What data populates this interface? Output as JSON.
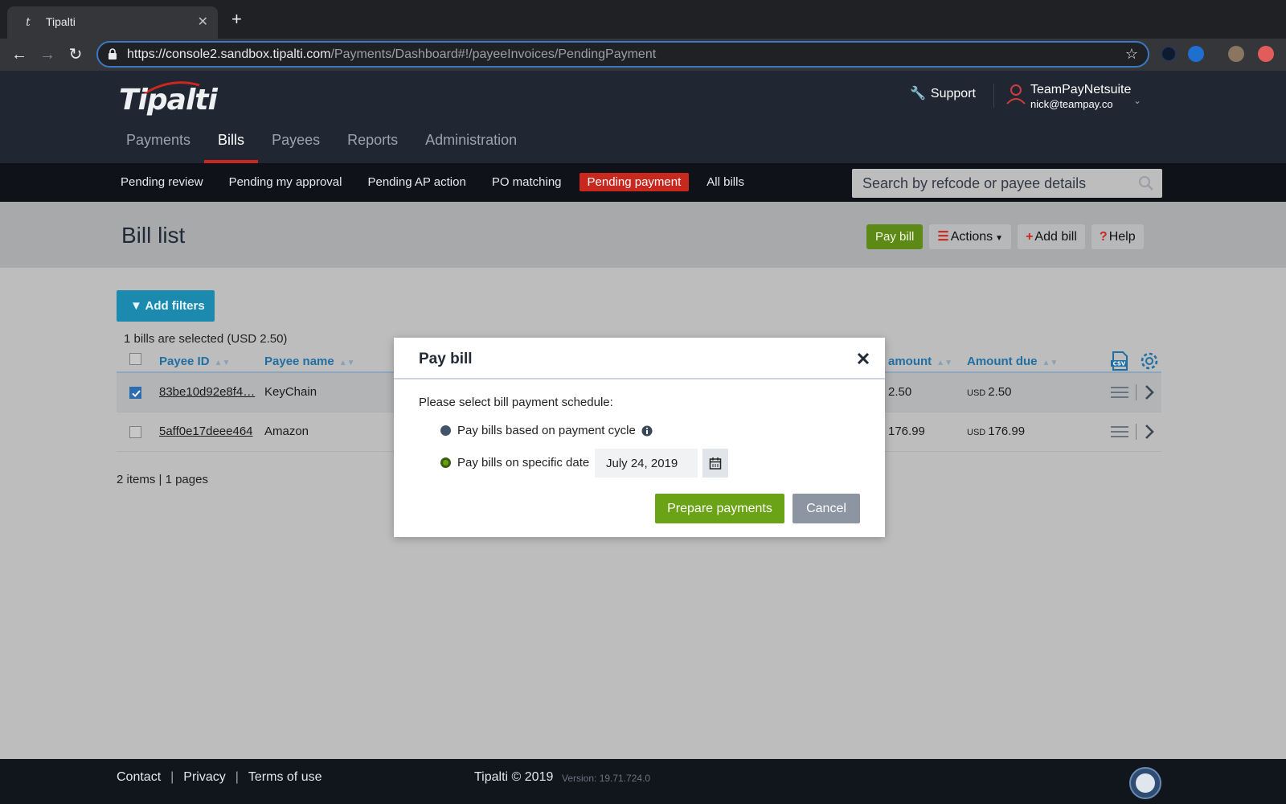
{
  "browser": {
    "tab_title": "Tipalti",
    "favicon_letter": "t",
    "url_host": "https://console2.sandbox.tipalti.com",
    "url_path": "/Payments/Dashboard#!/payeeInvoices/PendingPayment"
  },
  "header": {
    "logo": "Tipalti",
    "support_label": "Support",
    "user_name": "TeamPayNetsuite",
    "user_email": "nick@teampay.co"
  },
  "main_nav": [
    {
      "label": "Payments",
      "active": false
    },
    {
      "label": "Bills",
      "active": true
    },
    {
      "label": "Payees",
      "active": false
    },
    {
      "label": "Reports",
      "active": false
    },
    {
      "label": "Administration",
      "active": false
    }
  ],
  "sub_nav": [
    {
      "label": "Pending review",
      "active": false
    },
    {
      "label": "Pending my approval",
      "active": false
    },
    {
      "label": "Pending AP action",
      "active": false
    },
    {
      "label": "PO matching",
      "active": false
    },
    {
      "label": "Pending payment",
      "active": true
    },
    {
      "label": "All bills",
      "active": false
    }
  ],
  "search": {
    "placeholder": "Search by refcode or payee details"
  },
  "page": {
    "title": "Bill list",
    "pay_bill": "Pay bill",
    "actions": "Actions",
    "add_bill": "Add bill",
    "help": "Help",
    "add_filters": "Add filters",
    "selection_info": "1 bills are selected (USD 2.50)",
    "pager": "2 items | 1 pages"
  },
  "table": {
    "columns": {
      "payee_id": "Payee ID",
      "payee_name": "Payee name",
      "amount": "amount",
      "amount_due": "Amount due"
    },
    "rows": [
      {
        "payee_id": "83be10d92e8f4…",
        "payee_name": "KeyChain",
        "amount": "2.50",
        "currency": "USD",
        "amount_due": "2.50",
        "selected": true
      },
      {
        "payee_id": "5aff0e17deee464",
        "payee_name": "Amazon",
        "amount": "176.99",
        "currency": "USD",
        "amount_due": "176.99",
        "selected": false
      }
    ]
  },
  "modal": {
    "title": "Pay bill",
    "prompt": "Please select bill payment schedule:",
    "option_cycle": "Pay bills based on payment cycle",
    "option_date": "Pay bills on specific date",
    "date_value": "July 24, 2019",
    "prepare_label": "Prepare payments",
    "cancel_label": "Cancel",
    "selected_option": "specific_date"
  },
  "footer": {
    "contact": "Contact",
    "privacy": "Privacy",
    "terms": "Terms of use",
    "copyright": "Tipalti © 2019",
    "version": "Version: 19.71.724.0",
    "separator": "|"
  },
  "colors": {
    "brand_red": "#c8281e",
    "pay_green": "#6aa315",
    "filter_blue": "#1b8aae",
    "header_dark": "#202733"
  }
}
